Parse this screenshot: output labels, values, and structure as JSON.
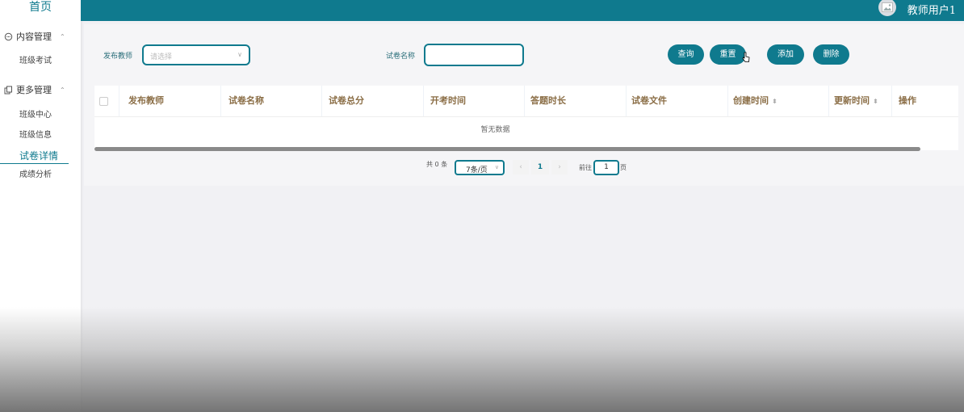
{
  "sidebar": {
    "home": "首页",
    "groups": [
      {
        "label": "内容管理",
        "items": [
          "班级考试"
        ]
      },
      {
        "label": "更多管理",
        "items": [
          "班级中心",
          "班级信息",
          "试卷详情",
          "成绩分析"
        ]
      }
    ]
  },
  "topbar": {
    "user_name": "教师用户1",
    "color": "#0f7a8e"
  },
  "filters": {
    "teacher_label": "发布教师",
    "teacher_placeholder": "请选择",
    "paper_name_label": "试卷名称",
    "paper_name_value": ""
  },
  "buttons": {
    "query": "查询",
    "reset": "重置",
    "add": "添加",
    "delete": "删除"
  },
  "table": {
    "columns": [
      "发布教师",
      "试卷名称",
      "试卷总分",
      "开考时间",
      "答题时长",
      "试卷文件",
      "创建时间",
      "更新时间",
      "操作"
    ],
    "empty_text": "暂无数据"
  },
  "pagination": {
    "total_prefix": "共",
    "total_count": "0",
    "total_suffix": "条",
    "page_size": "7条/页",
    "current_page": "1",
    "goto_prefix": "前往",
    "goto_value": "1",
    "goto_suffix": "页"
  }
}
